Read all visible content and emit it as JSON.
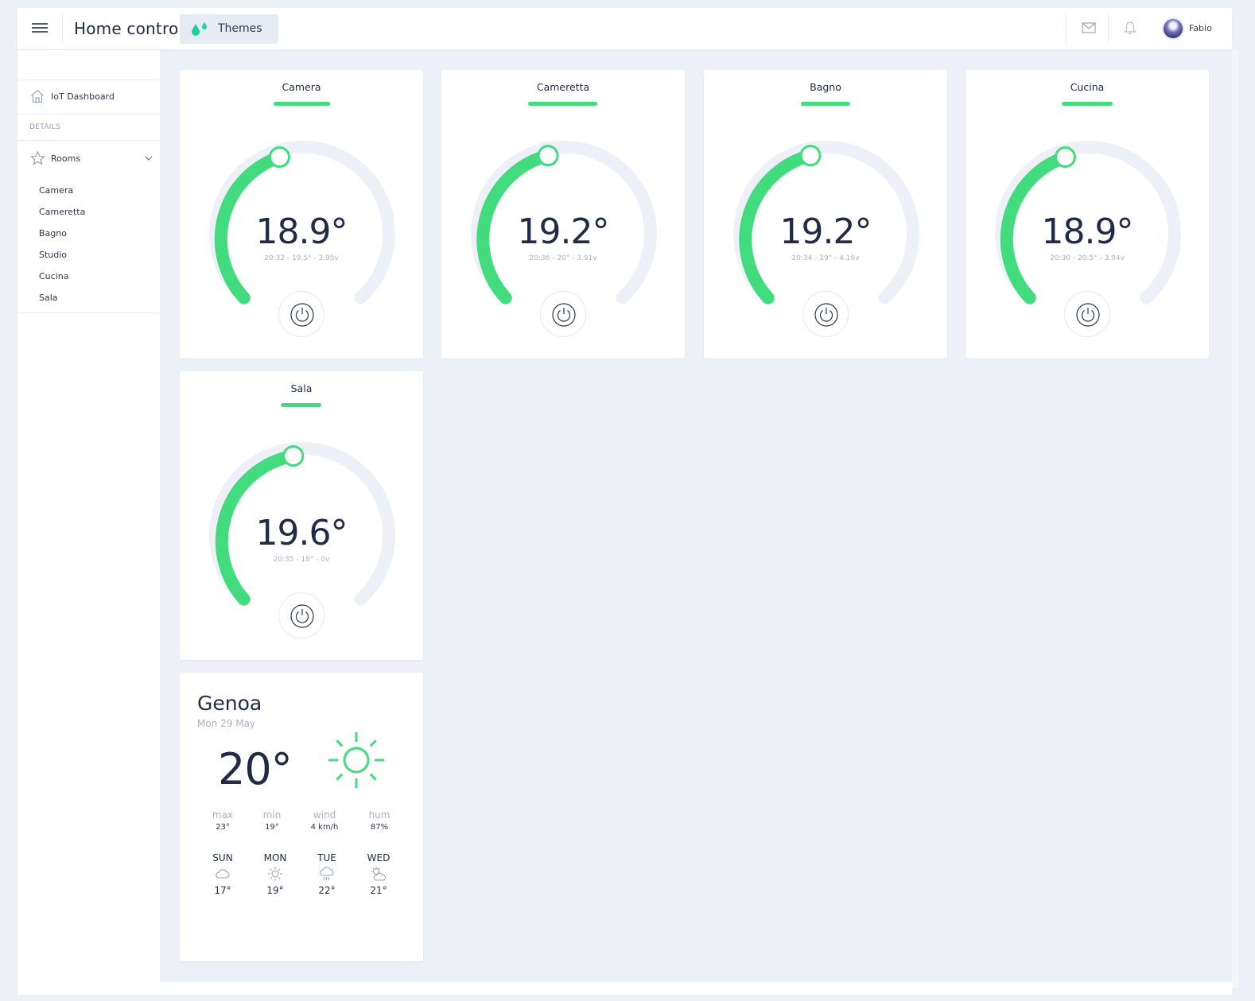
{
  "header": {
    "app_title": "Home control",
    "themes_label": "Themes",
    "user_name": "Fabio"
  },
  "sidebar": {
    "dashboard_label": "IoT Dashboard",
    "section_caption": "DETAILS",
    "rooms_label": "Rooms",
    "rooms": [
      "Camera",
      "Cameretta",
      "Bagno",
      "Studio",
      "Cucina",
      "Sala"
    ]
  },
  "thermostats": [
    {
      "room": "Camera",
      "temperature": "18.9°",
      "meta": "20:32 - 19.5° - 3.95v"
    },
    {
      "room": "Cameretta",
      "temperature": "19.2°",
      "meta": "20:36 - 20° - 3.91v"
    },
    {
      "room": "Bagno",
      "temperature": "19.2°",
      "meta": "20:34 - 19° - 4.16v"
    },
    {
      "room": "Cucina",
      "temperature": "18.9°",
      "meta": "20:30 - 20.5° - 3.94v"
    },
    {
      "room": "Sala",
      "temperature": "19.6°",
      "meta": "20:35 - 18° - 0v"
    }
  ],
  "weather": {
    "city": "Genoa",
    "date": "Mon 29 May",
    "temperature": "20°",
    "stats": [
      {
        "label": "max",
        "value": "23°"
      },
      {
        "label": "min",
        "value": "19°"
      },
      {
        "label": "wind",
        "value": "4 km/h"
      },
      {
        "label": "hum",
        "value": "87%"
      }
    ],
    "forecast": [
      {
        "day": "SUN",
        "icon": "cloud-icon",
        "temp": "17°"
      },
      {
        "day": "MON",
        "icon": "sun-icon",
        "temp": "19°"
      },
      {
        "day": "TUE",
        "icon": "rain-icon",
        "temp": "22°"
      },
      {
        "day": "WED",
        "icon": "partly-cloudy-icon",
        "temp": "21°"
      }
    ]
  },
  "colors": {
    "accent": "#42db7d",
    "track": "#edf1f7",
    "background": "#edf1f7"
  }
}
